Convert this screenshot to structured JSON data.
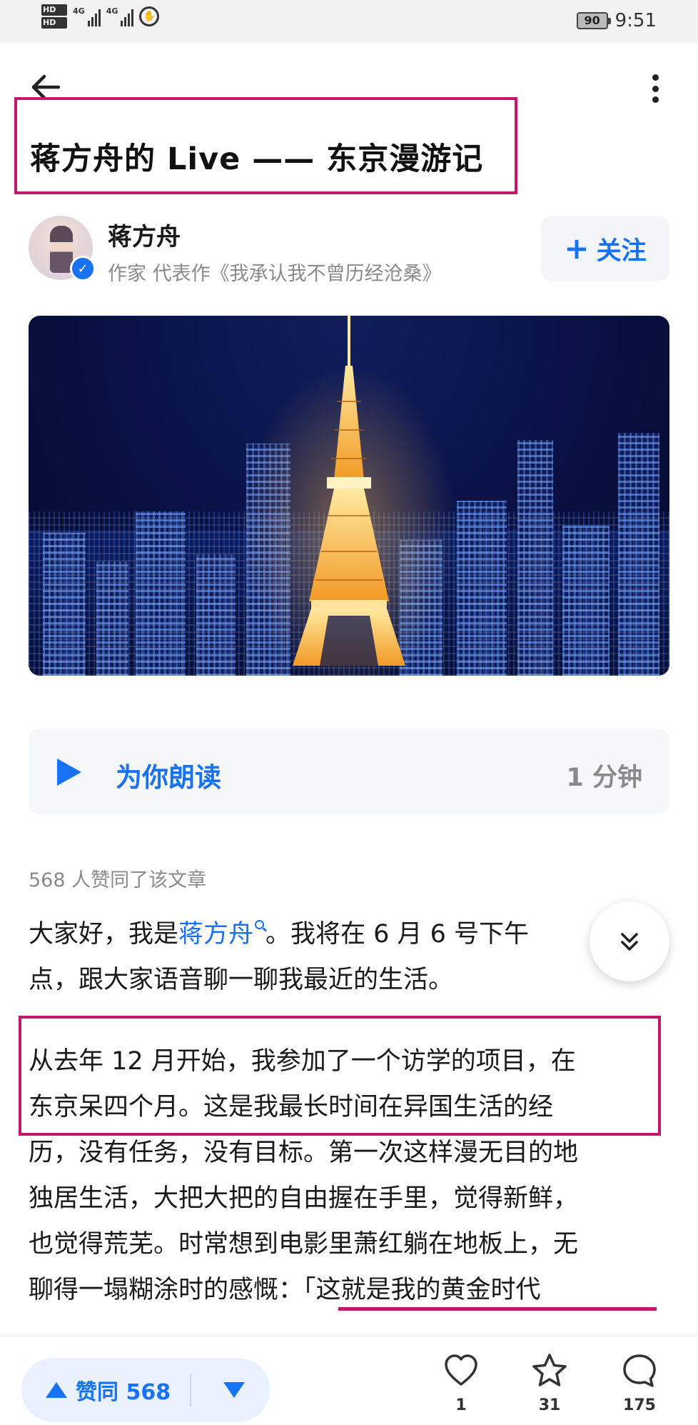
{
  "status_bar": {
    "hd_top": "HD",
    "hd_bottom": "HD",
    "signal_1_label": "4G",
    "signal_2_label": "4G",
    "battery": "90",
    "time": "9:51"
  },
  "article": {
    "title": "蒋方舟的 Live —— 东京漫游记",
    "author": {
      "name": "蒋方舟",
      "description": "作家 代表作《我承认我不曾历经沧桑》",
      "follow_label": "关注"
    },
    "read_aloud": {
      "label": "为你朗读",
      "duration": "1 分钟"
    },
    "likes_line": "568 人赞同了该文章",
    "paragraph_1": {
      "line_1_before": "大家好，我是",
      "line_1_mention": "蒋方舟",
      "line_1_after": "。我将在 6 月 6 号下午",
      "line_2": "点，跟大家语音聊一聊我最近的生活。"
    },
    "paragraph_2": {
      "lines": [
        "从去年 12 月开始，我参加了一个访学的项目，在",
        "东京呆四个月。这是我最长时间在异国生活的经",
        "历，没有任务，没有目标。第一次这样漫无目的地",
        "独居生活，大把大把的自由握在手里，觉得新鲜，",
        "也觉得荒芜。时常想到电影里萧红躺在地板上，无",
        "聊得一塌糊涂时的感慨：「这就是我的黄金时代"
      ]
    }
  },
  "bottom_bar": {
    "vote_up_label": "赞同 568",
    "like_count": "1",
    "favorite_count": "31",
    "comment_count": "175"
  },
  "colors": {
    "accent": "#1772f6",
    "annotation": "#c2186b"
  }
}
